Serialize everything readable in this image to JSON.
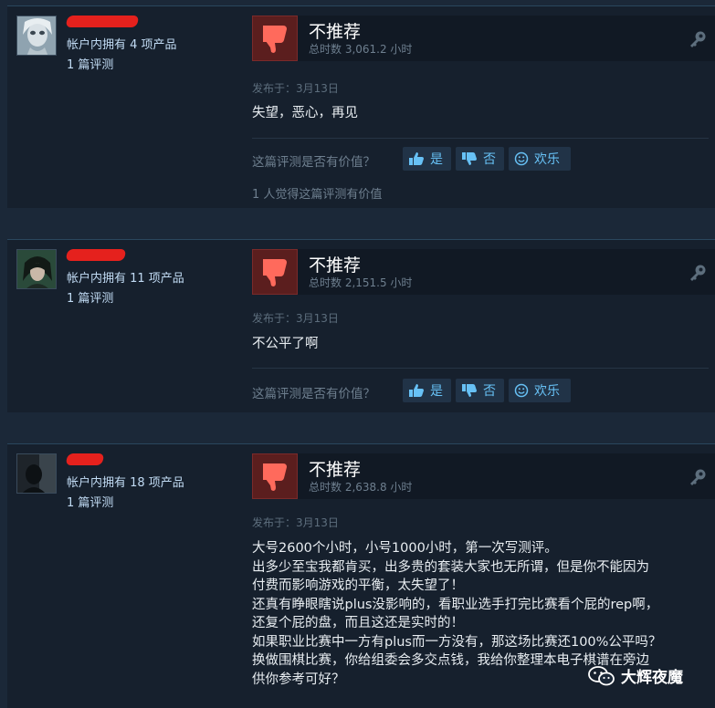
{
  "reviews": [
    {
      "author": {
        "products": "帐户内拥有 4 项产品",
        "reviews": "1 篇评测"
      },
      "rating": "不推荐",
      "hours": "总时数 3,061.2 小时",
      "posted": "发布于：3月13日",
      "content": [
        "失望，恶心，再见"
      ],
      "helpful_question": "这篇评测是否有价值？",
      "buttons": {
        "yes": "是",
        "no": "否",
        "funny": "欢乐"
      },
      "found_helpful": "1 人觉得这篇评测有价值"
    },
    {
      "author": {
        "products": "帐户内拥有 11 项产品",
        "reviews": "1 篇评测"
      },
      "rating": "不推荐",
      "hours": "总时数 2,151.5 小时",
      "posted": "发布于：3月13日",
      "content": [
        "不公平了啊"
      ],
      "helpful_question": "这篇评测是否有价值？",
      "buttons": {
        "yes": "是",
        "no": "否",
        "funny": "欢乐"
      }
    },
    {
      "author": {
        "products": "帐户内拥有 18 项产品",
        "reviews": "1 篇评测"
      },
      "rating": "不推荐",
      "hours": "总时数 2,638.8 小时",
      "posted": "发布于：3月13日",
      "content": [
        "大号2600个小时，小号1000小时，第一次写测评。",
        "出多少至宝我都肯买，出多贵的套装大家也无所谓，但是你不能因为",
        "付费而影响游戏的平衡，太失望了！",
        "还真有睁眼瞎说plus没影响的，看职业选手打完比赛看个屁的rep啊，",
        "还复个屁的盘，而且这还是实时的！",
        "如果职业比赛中一方有plus而一方没有，那这场比赛还100%公平吗？",
        "换做围棋比赛，你给组委会多交点钱，我给你整理本电子棋谱在旁边",
        "供你参考可好？"
      ]
    }
  ],
  "watermark": "大辉夜魔",
  "colors": {
    "background": "#1b2838",
    "card": "#16202d",
    "thumb_down_bg": "#5b1e1e",
    "link_blue": "#67c1f5",
    "redaction": "#e5211d"
  },
  "icons": [
    "thumbs-down-icon",
    "key-icon",
    "thumbs-up-icon",
    "smiley-icon",
    "wechat-icon"
  ]
}
